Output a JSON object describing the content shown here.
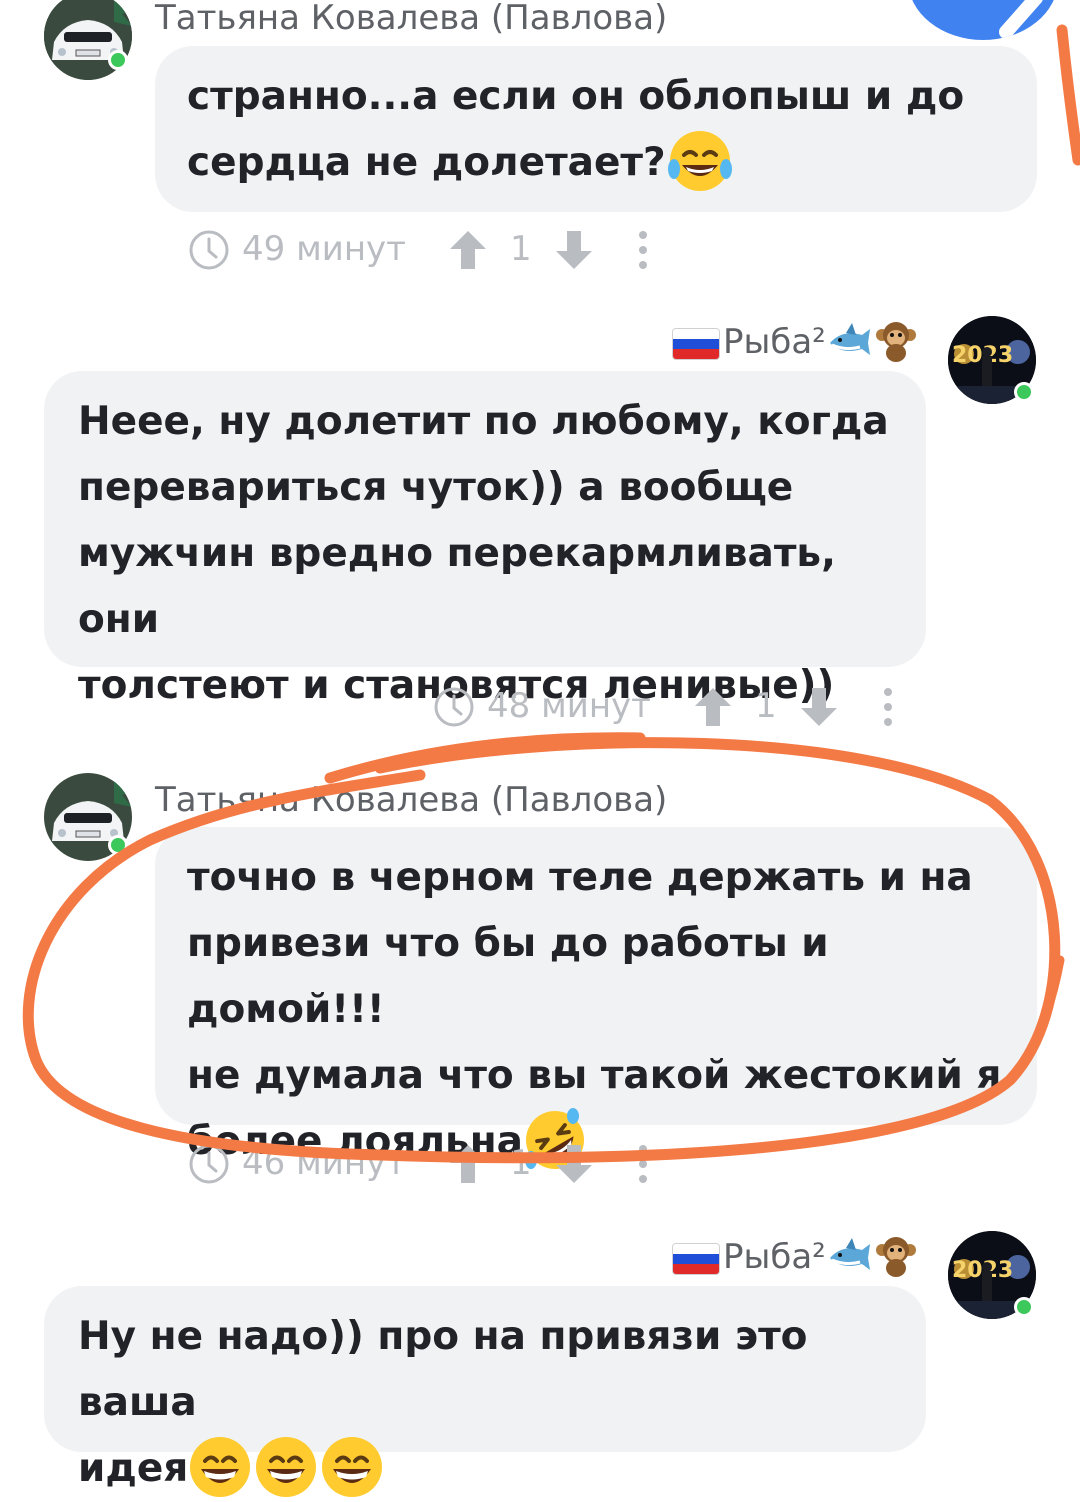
{
  "thread": {
    "comments": [
      {
        "author": "Татьяна Ковалева (Павлова)",
        "text_lines": [
          "странно...а если он облопыш и до",
          "сердца не долетает?"
        ],
        "time": "49 минут",
        "votes": "1"
      },
      {
        "author": "Рыба²",
        "text_lines": [
          "Неее, ну долетит по любому, когда",
          "перевариться чуток)) а вообще",
          "мужчин вредно перекармливать, они",
          "толстеют и становятся ленивые))"
        ],
        "time": "48 минут",
        "votes": "1"
      },
      {
        "author": "Татьяна Ковалева (Павлова)",
        "text_lines": [
          "точно в черном теле держать и на",
          "привези что бы до работы и домой!!!",
          "не думала что вы такой жестокий я",
          "более лояльна"
        ],
        "time": "46 минут",
        "votes": "1"
      },
      {
        "author": "Рыба²",
        "text_lines": [
          "Ну не надо)) про на привязи это ваша",
          "идея"
        ]
      }
    ]
  },
  "colors": {
    "annotation_stroke": "#f47a45",
    "bubble_bg": "#f1f2f4",
    "online": "#3cc85a",
    "fab_blue": "#3f82f0"
  },
  "icons": [
    "clock-icon",
    "arrow-up-icon",
    "arrow-down-icon",
    "more-vertical-icon",
    "russia-flag-icon",
    "shark-emoji",
    "monkey-emoji",
    "laughing-tears-emoji",
    "rolling-laughing-emoji",
    "grinning-emoji"
  ]
}
